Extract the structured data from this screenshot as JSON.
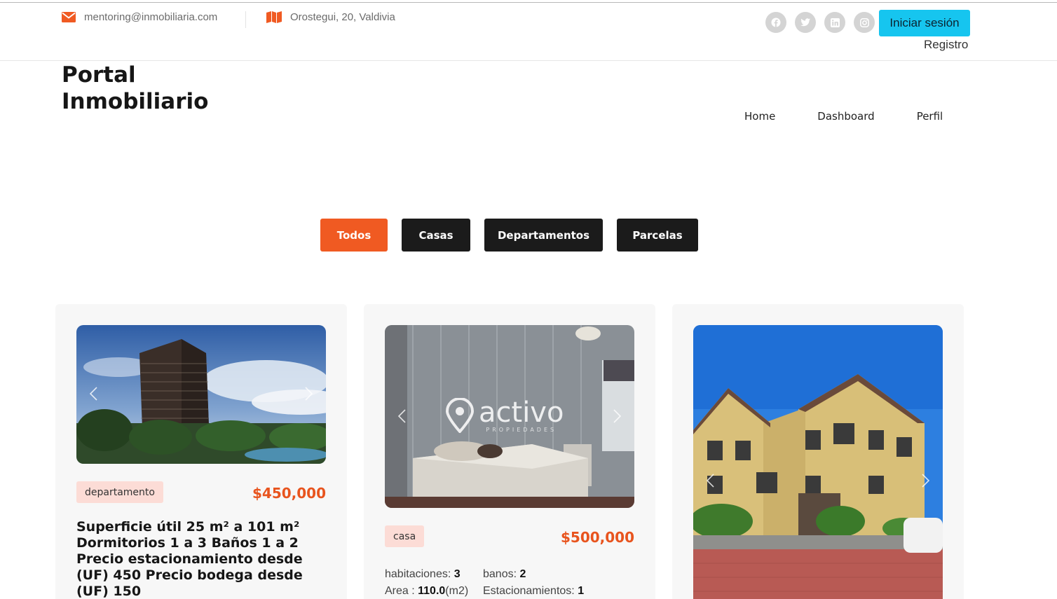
{
  "topbar": {
    "email": "mentoring@inmobiliaria.com",
    "address": "Orostegui, 20, Valdivia",
    "login_label": "Iniciar sesión",
    "register_label": "Registro",
    "socials": [
      "facebook-icon",
      "twitter-icon",
      "linkedin-icon",
      "instagram-icon"
    ]
  },
  "brand": {
    "line1": "Portal",
    "line2": "Inmobiliario"
  },
  "nav": {
    "home": "Home",
    "dashboard": "Dashboard",
    "profile": "Perfil"
  },
  "filters": {
    "all": "Todos",
    "houses": "Casas",
    "apartments": "Departamentos",
    "plots": "Parcelas",
    "active": "Todos"
  },
  "colors": {
    "accent": "#f05a22",
    "login": "#16c5ef",
    "dark": "#1b1b1b",
    "badge_bg": "#fcdcd6",
    "price": "#e8541e"
  },
  "cards": [
    {
      "type": "departamento",
      "price": "$450,000",
      "description": "Superficie útil 25 m² a 101 m² Dormitorios 1 a 3 Baños 1 a 2 Precio estacionamiento desde (UF) 450 Precio bodega desde (UF) 150"
    },
    {
      "type": "casa",
      "price": "$500,000",
      "watermark": "activo",
      "watermark_sub": "PROPIEDADES",
      "specs": {
        "rooms_label": "habitaciones:",
        "rooms": "3",
        "baths_label": "banos:",
        "baths": "2",
        "area_label": "Area :",
        "area": "110.0",
        "area_unit": "(m2)",
        "parking_label": "Estacionamientos:",
        "parking": "1"
      }
    },
    {}
  ]
}
